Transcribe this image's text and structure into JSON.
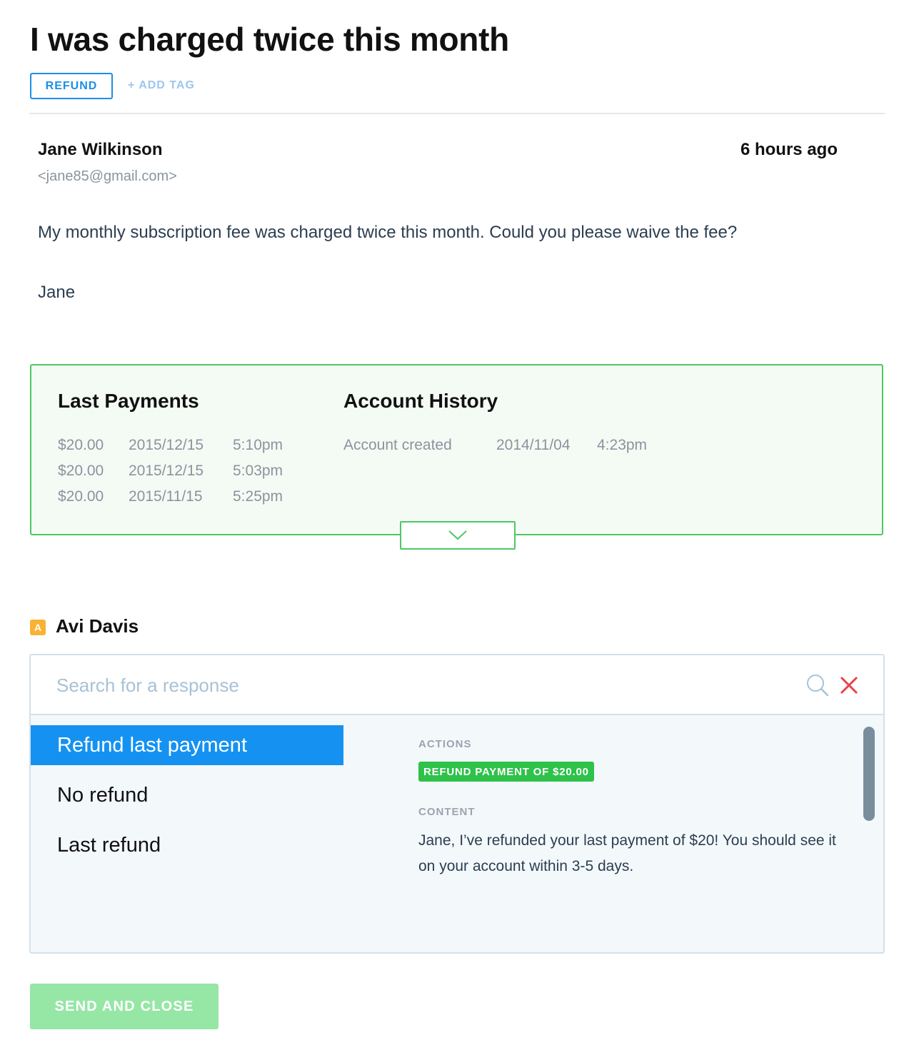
{
  "ticket": {
    "title": "I was charged twice this month",
    "tag": "REFUND",
    "add_tag_label": "+ ADD TAG"
  },
  "message": {
    "sender_name": "Jane Wilkinson",
    "sender_email": "<jane85@gmail.com>",
    "time_ago": "6 hours ago",
    "body_line1": "My monthly subscription fee was charged twice this month. Could you please waive the fee?",
    "body_line2": "Jane"
  },
  "info": {
    "payments_title": "Last Payments",
    "payments": [
      {
        "amount": "$20.00",
        "date": "2015/12/15",
        "time": "5:10pm"
      },
      {
        "amount": "$20.00",
        "date": "2015/12/15",
        "time": "5:03pm"
      },
      {
        "amount": "$20.00",
        "date": "2015/11/15",
        "time": "5:25pm"
      }
    ],
    "history_title": "Account History",
    "history": [
      {
        "event": "Account created",
        "date": "2014/11/04",
        "time": "4:23pm"
      }
    ],
    "expand_icon": "chevron-down-icon"
  },
  "agent": {
    "initial": "A",
    "name": "Avi Davis"
  },
  "responses": {
    "search_placeholder": "Search for a response",
    "search_value": "",
    "items": [
      {
        "label": "Refund last payment",
        "selected": true
      },
      {
        "label": "No refund",
        "selected": false
      },
      {
        "label": "Last refund",
        "selected": false
      }
    ],
    "actions_label": "ACTIONS",
    "action_badge": "REFUND PAYMENT OF $20.00",
    "content_label": "CONTENT",
    "content_text": "Jane, I’ve refunded your last payment of $20! You should see it on your account within 3-5 days."
  },
  "footer": {
    "send_label": "SEND AND CLOSE"
  },
  "colors": {
    "accent_blue": "#1592f1",
    "success_green": "#2ec24a",
    "box_border_green": "#4cc864",
    "send_button_green": "#96e6a6",
    "close_red": "#e8424a",
    "agent_badge": "#f9b233"
  }
}
